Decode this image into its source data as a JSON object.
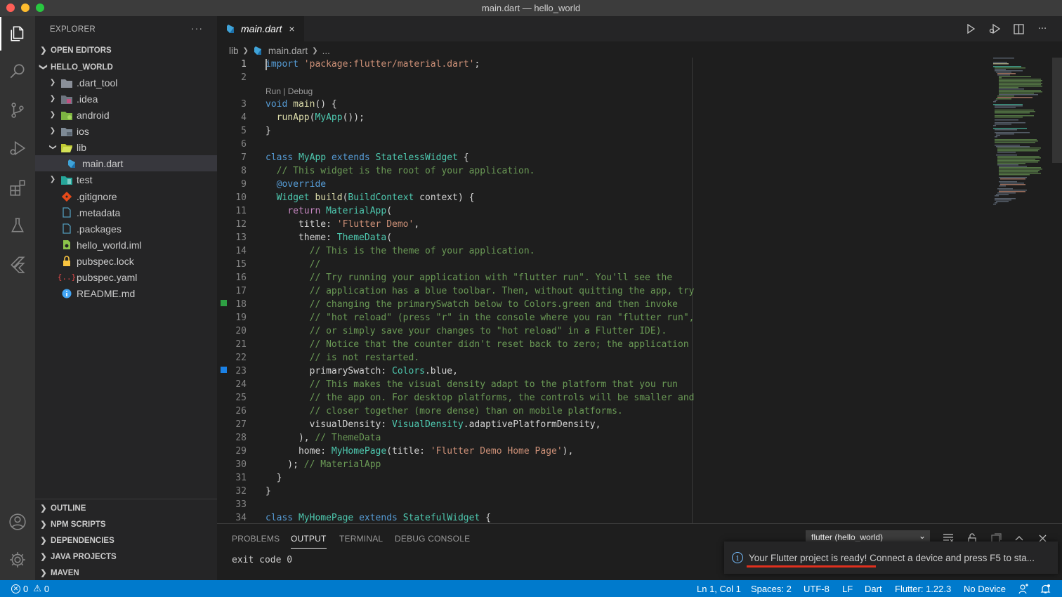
{
  "window": {
    "title": "main.dart — hello_world"
  },
  "activity_bar": {
    "items": [
      "explorer",
      "search",
      "source-control",
      "run-and-debug",
      "extensions",
      "testing",
      "flutter",
      "accounts",
      "manage"
    ]
  },
  "sidebar": {
    "header": "EXPLORER",
    "more": "···",
    "open_editors": "OPEN EDITORS",
    "workspace": "HELLO_WORLD",
    "tree": [
      {
        "label": ".dart_tool",
        "kind": "folder"
      },
      {
        "label": ".idea",
        "kind": "folder"
      },
      {
        "label": "android",
        "kind": "folder"
      },
      {
        "label": "ios",
        "kind": "folder"
      },
      {
        "label": "lib",
        "kind": "folder-open"
      },
      {
        "label": "main.dart",
        "kind": "dart-file"
      },
      {
        "label": "test",
        "kind": "folder"
      },
      {
        "label": ".gitignore",
        "kind": "git-file"
      },
      {
        "label": ".metadata",
        "kind": "file"
      },
      {
        "label": ".packages",
        "kind": "file"
      },
      {
        "label": "hello_world.iml",
        "kind": "iml-file"
      },
      {
        "label": "pubspec.lock",
        "kind": "lock-file"
      },
      {
        "label": "pubspec.yaml",
        "kind": "yaml-file"
      },
      {
        "label": "README.md",
        "kind": "info-file"
      }
    ],
    "bottom_sections": [
      "OUTLINE",
      "NPM SCRIPTS",
      "DEPENDENCIES",
      "JAVA PROJECTS",
      "MAVEN"
    ]
  },
  "editor": {
    "tab": {
      "label": "main.dart",
      "close": "×"
    },
    "breadcrumb": {
      "folder": "lib",
      "file": "main.dart",
      "rest": "..."
    },
    "codelens": "Run | Debug",
    "line_numbers": [
      "1",
      "2",
      "3",
      "4",
      "5",
      "6",
      "7",
      "8",
      "9",
      "10",
      "11",
      "12",
      "13",
      "14",
      "15",
      "16",
      "17",
      "18",
      "19",
      "20",
      "21",
      "22",
      "23",
      "24",
      "25",
      "26",
      "27",
      "28",
      "29",
      "30",
      "31",
      "32",
      "33",
      "34"
    ]
  },
  "panel": {
    "tabs": [
      "PROBLEMS",
      "OUTPUT",
      "TERMINAL",
      "DEBUG CONSOLE"
    ],
    "active_tab": "OUTPUT",
    "channel": "flutter (hello_world)",
    "output_text": "exit code 0"
  },
  "notification": {
    "text": "Your Flutter project is ready! Connect a device and press F5 to sta..."
  },
  "status_bar": {
    "errors": "0",
    "warnings": "0",
    "position": "Ln 1, Col 1",
    "spaces": "Spaces: 2",
    "encoding": "UTF-8",
    "eol": "LF",
    "language": "Dart",
    "flutter_version": "Flutter: 1.22.3",
    "device": "No Device"
  },
  "colors": {
    "accent": "#007acc",
    "titlebar": "#3c3c3c",
    "sidebar": "#252526",
    "editor": "#1e1e1e",
    "activity": "#333333"
  }
}
